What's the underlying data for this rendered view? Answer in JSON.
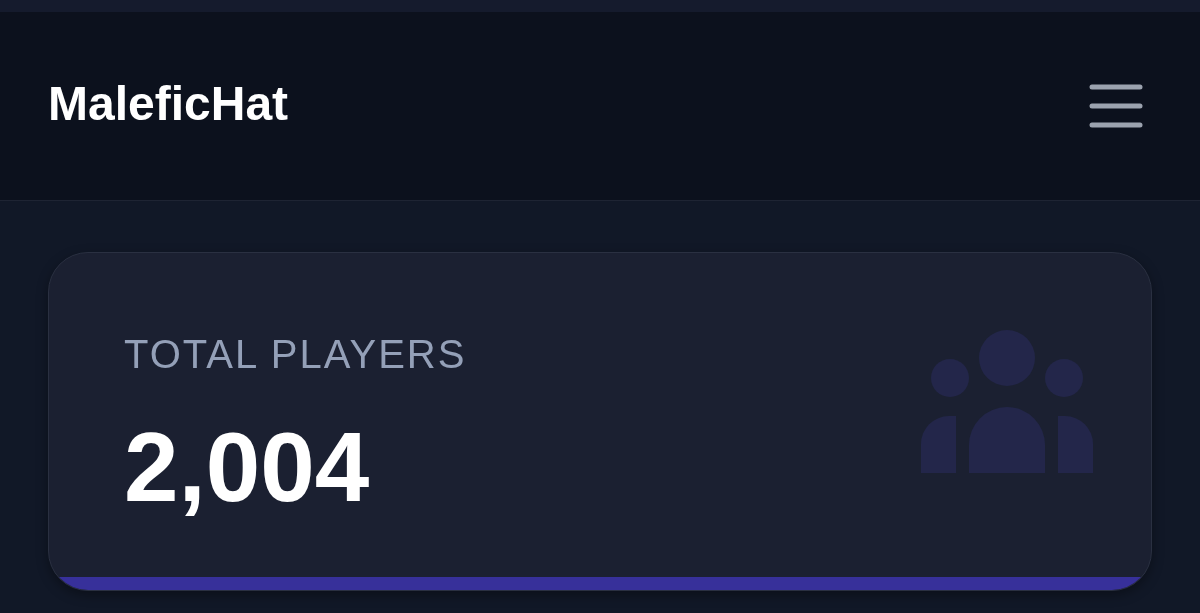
{
  "header": {
    "title": "MaleficHat"
  },
  "stat_card": {
    "label": "TOTAL PLAYERS",
    "value": "2,004"
  }
}
